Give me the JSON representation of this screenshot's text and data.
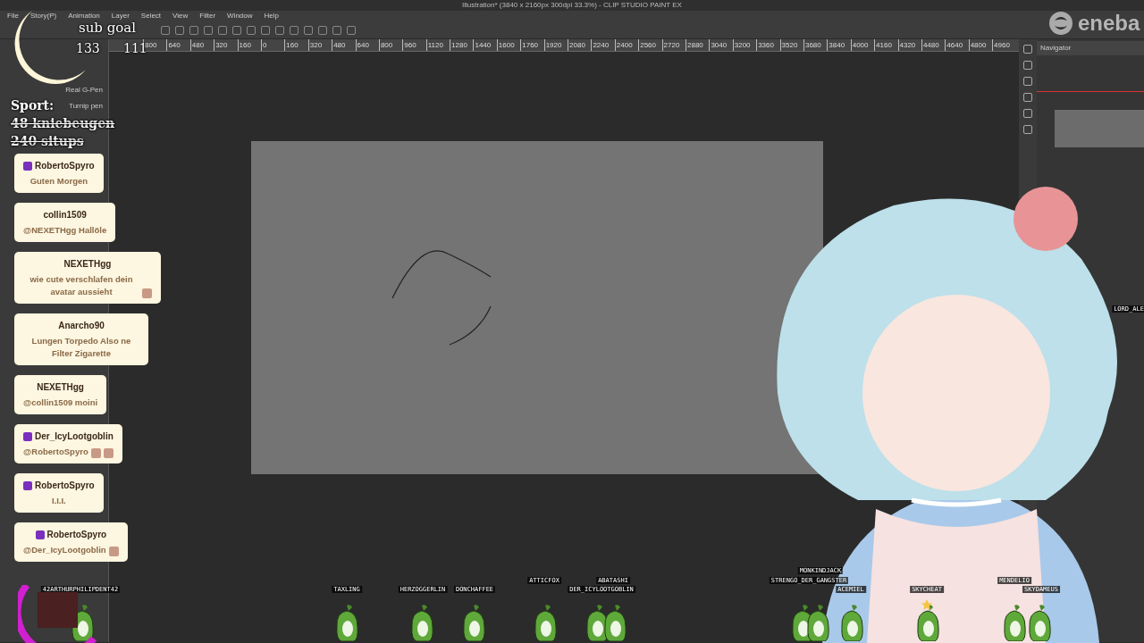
{
  "window": {
    "title": "Illustration* (3840 x 2160px 300dpi 33.3%) - CLIP STUDIO PAINT EX"
  },
  "menu": [
    "File",
    "Story(P)",
    "Animation",
    "Layer",
    "Select",
    "View",
    "Filter",
    "Window",
    "Help"
  ],
  "ruler": [
    "800",
    "640",
    "480",
    "320",
    "160",
    "0",
    "160",
    "320",
    "480",
    "640",
    "800",
    "960",
    "1120",
    "1280",
    "1440",
    "1600",
    "1760",
    "1920",
    "2080",
    "2240",
    "2400",
    "2560",
    "2720",
    "2880",
    "3040",
    "3200",
    "3360",
    "3520",
    "3680",
    "3840",
    "4000",
    "4160",
    "4320",
    "4480",
    "4640",
    "4800",
    "4960"
  ],
  "sub_tools": [
    "Real G-Pen",
    "Turnip pen"
  ],
  "right_panel": {
    "title": "Navigator"
  },
  "sub_goal": {
    "label": "sub goal",
    "current": "133",
    "target": "111"
  },
  "sport": {
    "title": "Sport:",
    "goals": [
      {
        "text": "48 kniebeugen",
        "done": true
      },
      {
        "text": "240 situps",
        "done": true
      }
    ]
  },
  "chat": [
    {
      "user": "RobertoSpyro",
      "subscriber": true,
      "text": "Guten Morgen"
    },
    {
      "user": "collin1509",
      "subscriber": false,
      "text": "@NEXETHgg Hallöle"
    },
    {
      "user": "NEXETHgg",
      "subscriber": false,
      "text": "wie cute verschlafen dein avatar aussieht"
    },
    {
      "user": "Anarcho90",
      "subscriber": false,
      "text": "Lungen Torpedo Also ne Filter Zigarette"
    },
    {
      "user": "NEXETHgg",
      "subscriber": false,
      "text": "@collin1509 moini"
    },
    {
      "user": "Der_IcyLootgoblin",
      "subscriber": true,
      "text": "@RobertoSpyro"
    },
    {
      "user": "RobertoSpyro",
      "subscriber": true,
      "text": "I.I.I."
    },
    {
      "user": "RobertoSpyro",
      "subscriber": true,
      "text": "@Der_IcyLootgoblin"
    }
  ],
  "viewers": [
    {
      "name": "42ARTHURPHILIPDENT42"
    },
    {
      "name": "TAXLING"
    },
    {
      "name": "HERZOGGERLIN"
    },
    {
      "name": "DONCHAFFEE"
    },
    {
      "name": "ATTICFOX"
    },
    {
      "name": "ABATASHI"
    },
    {
      "name": "DER_ICYLOOTGOBLIN"
    },
    {
      "name": "MONKINDJACK"
    },
    {
      "name": "STRENGO_DER_GANGSTER"
    },
    {
      "name": "ACEMIEL"
    },
    {
      "name": "SKYCHEAT"
    },
    {
      "name": "MENDELIO"
    },
    {
      "name": "SKYDAMEUS"
    },
    {
      "name": "LORD_ALE"
    }
  ],
  "sponsor": {
    "name": "eneba"
  }
}
